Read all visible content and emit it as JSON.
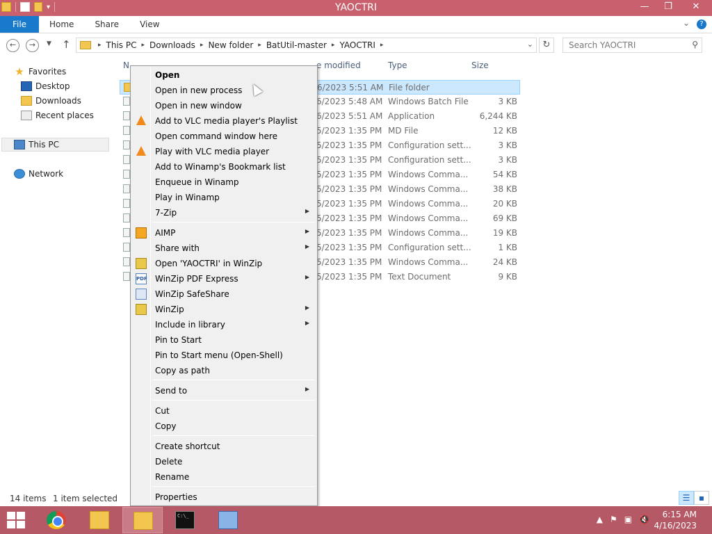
{
  "window": {
    "title": "YAOCTRI",
    "controls": {
      "minimize": "—",
      "maximize": "❐",
      "close": "✕"
    }
  },
  "ribbon": {
    "tabs": [
      "File",
      "Home",
      "Share",
      "View"
    ],
    "help": "?"
  },
  "address": {
    "crumbs": [
      "This PC",
      "Downloads",
      "New folder",
      "BatUtil-master",
      "YAOCTRI"
    ],
    "search_placeholder": "Search YAOCTRI"
  },
  "nav": {
    "favorites": "Favorites",
    "desktop": "Desktop",
    "downloads": "Downloads",
    "recent": "Recent places",
    "this_pc": "This PC",
    "network": "Network"
  },
  "columns": {
    "name": "N",
    "modified": "e modified",
    "type": "Type",
    "size": "Size"
  },
  "files": [
    {
      "modified": "6/2023 5:51 AM",
      "type": "File folder",
      "size": ""
    },
    {
      "modified": "6/2023 5:48 AM",
      "type": "Windows Batch File",
      "size": "3 KB"
    },
    {
      "modified": "6/2023 5:51 AM",
      "type": "Application",
      "size": "6,244 KB"
    },
    {
      "modified": "5/2023 1:35 PM",
      "type": "MD File",
      "size": "12 KB"
    },
    {
      "modified": "5/2023 1:35 PM",
      "type": "Configuration sett...",
      "size": "3 KB"
    },
    {
      "modified": "5/2023 1:35 PM",
      "type": "Configuration sett...",
      "size": "3 KB"
    },
    {
      "modified": "5/2023 1:35 PM",
      "type": "Windows Comma...",
      "size": "54 KB"
    },
    {
      "modified": "5/2023 1:35 PM",
      "type": "Windows Comma...",
      "size": "38 KB"
    },
    {
      "modified": "5/2023 1:35 PM",
      "type": "Windows Comma...",
      "size": "20 KB"
    },
    {
      "modified": "5/2023 1:35 PM",
      "type": "Windows Comma...",
      "size": "69 KB"
    },
    {
      "modified": "5/2023 1:35 PM",
      "type": "Windows Comma...",
      "size": "19 KB"
    },
    {
      "modified": "5/2023 1:35 PM",
      "type": "Configuration sett...",
      "size": "1 KB"
    },
    {
      "modified": "5/2023 1:35 PM",
      "type": "Windows Comma...",
      "size": "24 KB"
    },
    {
      "modified": "5/2023 1:35 PM",
      "type": "Text Document",
      "size": "9 KB"
    }
  ],
  "status": {
    "items": "14 items",
    "selected": "1 item selected"
  },
  "context_menu": {
    "items": [
      {
        "label": "Open",
        "bold": true
      },
      {
        "label": "Open in new process"
      },
      {
        "label": "Open in new window"
      },
      {
        "label": "Add to VLC media player's Playlist",
        "icon": "vlc-icon"
      },
      {
        "label": "Open command window here"
      },
      {
        "label": "Play with VLC media player",
        "icon": "vlc-icon"
      },
      {
        "label": "Add to Winamp's Bookmark list"
      },
      {
        "label": "Enqueue in Winamp"
      },
      {
        "label": "Play in Winamp"
      },
      {
        "label": "7-Zip",
        "submenu": true
      },
      {
        "separator": true
      },
      {
        "label": "AIMP",
        "submenu": true,
        "icon": "aimp-icon"
      },
      {
        "label": "Share with",
        "submenu": true
      },
      {
        "label": "Open 'YAOCTRI' in WinZip",
        "icon": "winzip-icon"
      },
      {
        "label": "WinZip PDF Express",
        "submenu": true,
        "icon": "pdf-icon"
      },
      {
        "label": "WinZip SafeShare",
        "icon": "safeshare-icon"
      },
      {
        "label": "WinZip",
        "submenu": true,
        "icon": "winzip-icon"
      },
      {
        "label": "Include in library",
        "submenu": true
      },
      {
        "label": "Pin to Start"
      },
      {
        "label": "Pin to Start menu (Open-Shell)"
      },
      {
        "label": "Copy as path"
      },
      {
        "separator": true
      },
      {
        "label": "Send to",
        "submenu": true
      },
      {
        "separator": true
      },
      {
        "label": "Cut"
      },
      {
        "label": "Copy"
      },
      {
        "separator": true
      },
      {
        "label": "Create shortcut"
      },
      {
        "label": "Delete"
      },
      {
        "label": "Rename"
      },
      {
        "separator": true
      },
      {
        "label": "Properties"
      }
    ]
  },
  "taskbar": {
    "apps": [
      "chrome-icon",
      "file-explorer-icon",
      "file-explorer-icon",
      "cmd-icon",
      "remote-desktop-icon"
    ],
    "cmd_glyph": "C:\\_",
    "clock_time": "6:15 AM",
    "clock_date": "4/16/2023"
  },
  "colors": {
    "titlebar": "#c9606d",
    "taskbar": "#b65966",
    "accent": "#1979ca",
    "selection": "#cce8ff"
  }
}
